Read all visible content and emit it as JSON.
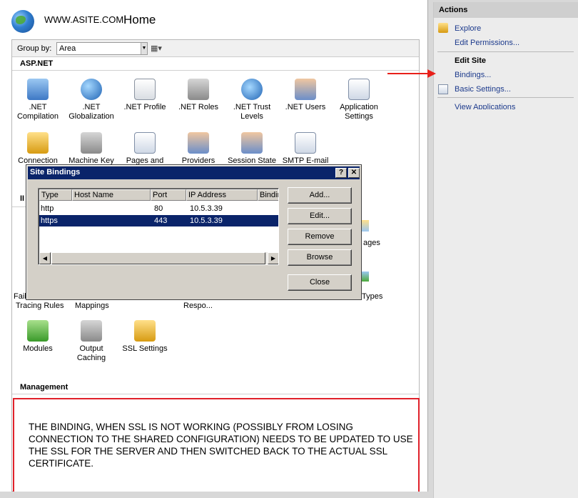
{
  "header": {
    "site_name": "WWW.ASITE.COM",
    "page_title": "Home"
  },
  "group_by": {
    "label": "Group by:",
    "value": "Area"
  },
  "sections": {
    "aspnet": "ASP.NET",
    "iis_partial": "II",
    "management": "Management"
  },
  "features_row1": [
    {
      "icon": "dotnet-compilation-icon",
      "line1": ".NET",
      "line2": "Compilation"
    },
    {
      "icon": "dotnet-globalization-icon",
      "line1": ".NET",
      "line2": "Globalization"
    },
    {
      "icon": "dotnet-profile-icon",
      "line1": ".NET Profile",
      "line2": ""
    },
    {
      "icon": "dotnet-roles-icon",
      "line1": ".NET Roles",
      "line2": ""
    },
    {
      "icon": "dotnet-trust-levels-icon",
      "line1": ".NET Trust",
      "line2": "Levels"
    },
    {
      "icon": "dotnet-users-icon",
      "line1": ".NET Users",
      "line2": ""
    },
    {
      "icon": "application-settings-icon",
      "line1": "Application",
      "line2": "Settings"
    }
  ],
  "features_row2": [
    {
      "icon": "connection-strings-icon",
      "line1": "Connection"
    },
    {
      "icon": "machine-key-icon",
      "line1": "Machine Key"
    },
    {
      "icon": "pages-and-controls-icon",
      "line1": "Pages and"
    },
    {
      "icon": "providers-icon",
      "line1": "Providers"
    },
    {
      "icon": "session-state-icon",
      "line1": "Session State"
    },
    {
      "icon": "smtp-email-icon",
      "line1": "SMTP E-mail"
    }
  ],
  "features_iis_partial": {
    "failed_prefix": "Faile",
    "tracing_rules": "Tracing Rules",
    "mappings": "Mappings",
    "response_partial": "Respo...",
    "pages_suffix": "ages",
    "types_suffix": "Types"
  },
  "features_row4": [
    {
      "icon": "modules-icon",
      "line1": "Modules",
      "line2": ""
    },
    {
      "icon": "output-caching-icon",
      "line1": "Output",
      "line2": "Caching"
    },
    {
      "icon": "ssl-settings-icon",
      "line1": "SSL Settings",
      "line2": ""
    }
  ],
  "note": "THE BINDING, WHEN SSL IS NOT WORKING (POSSIBLY FROM LOSING CONNECTION TO THE SHARED CONFIGURATION) NEEDS TO BE UPDATED TO USE THE SSL FOR THE SERVER AND THEN SWITCHED BACK TO THE ACTUAL SSL CERTIFICATE.",
  "actions": {
    "title": "Actions",
    "explore": "Explore",
    "edit_permissions": "Edit Permissions...",
    "edit_site": "Edit Site",
    "bindings": "Bindings...",
    "basic_settings": "Basic Settings...",
    "view_applications": "View Applications"
  },
  "dialog": {
    "title": "Site Bindings",
    "help": "?",
    "close_x": "✕",
    "columns": [
      "Type",
      "Host Name",
      "Port",
      "IP Address",
      "Bindin"
    ],
    "rows": [
      {
        "type": "http",
        "host": "",
        "port": "80",
        "ip": "10.5.3.39",
        "selected": false
      },
      {
        "type": "https",
        "host": "",
        "port": "443",
        "ip": "10.5.3.39",
        "selected": true
      }
    ],
    "buttons": {
      "add": "Add...",
      "edit": "Edit...",
      "remove": "Remove",
      "browse": "Browse",
      "close": "Close"
    }
  },
  "colors": {
    "highlight_box": "#e0202a",
    "arrow": "#e8201a",
    "selection": "#0a246a",
    "dialog_title_bg": "#0a246a"
  }
}
